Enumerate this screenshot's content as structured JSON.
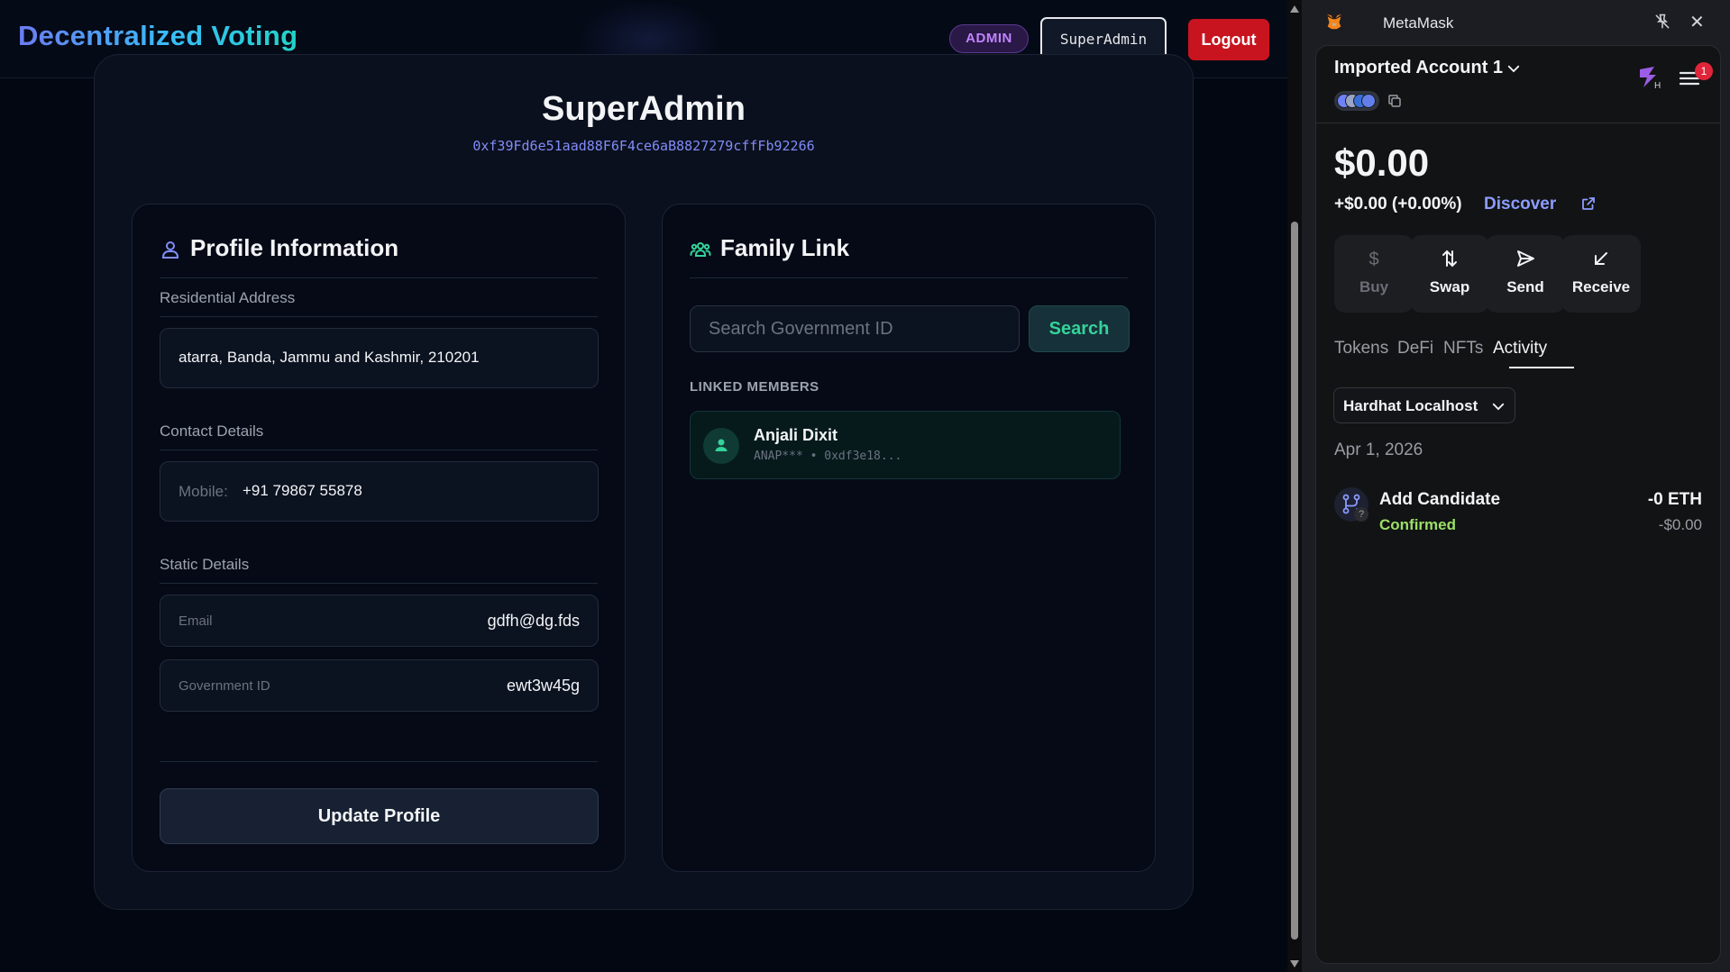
{
  "app": {
    "brand": "Decentralized Voting",
    "role_badge": "ADMIN",
    "user_button": "SuperAdmin",
    "logout_label": "Logout"
  },
  "profile": {
    "name": "SuperAdmin",
    "wallet": "0xf39Fd6e51aad88F6F4ce6aB8827279cffFb92266"
  },
  "profile_panel": {
    "title": "Profile Information",
    "residential_label": "Residential Address",
    "address_value": "atarra, Banda, Jammu and Kashmir, 210201",
    "contact_label": "Contact Details",
    "mobile_label": "Mobile:",
    "mobile_value": "+91 79867 55878",
    "static_label": "Static Details",
    "email_label": "Email",
    "email_value": "gdfh@dg.fds",
    "govid_label": "Government ID",
    "govid_value": "ewt3w45g",
    "update_label": "Update Profile"
  },
  "family_panel": {
    "title": "Family Link",
    "search_placeholder": "Search Government ID",
    "search_label": "Search",
    "linked_label": "LINKED MEMBERS",
    "members": [
      {
        "name": "Anjali Dixit",
        "sub": "ANAP*** • 0xdf3e18..."
      }
    ]
  },
  "metamask": {
    "title": "MetaMask",
    "account": "Imported Account 1",
    "notifications": "1",
    "balance": "$0.00",
    "change": "+$0.00 (+0.00%)",
    "discover": "Discover",
    "actions": [
      {
        "label": "Buy",
        "icon": "dollar-icon",
        "enabled": false
      },
      {
        "label": "Swap",
        "icon": "swap-icon",
        "enabled": true
      },
      {
        "label": "Send",
        "icon": "send-icon",
        "enabled": true
      },
      {
        "label": "Receive",
        "icon": "receive-icon",
        "enabled": true
      }
    ],
    "tabs": [
      "Tokens",
      "DeFi",
      "NFTs",
      "Activity"
    ],
    "active_tab": "Activity",
    "network": "Hardhat Localhost",
    "date": "Apr 1, 2026",
    "tx": {
      "title": "Add Candidate",
      "status": "Confirmed",
      "amount": "-0 ETH",
      "fiat": "-$0.00"
    }
  }
}
